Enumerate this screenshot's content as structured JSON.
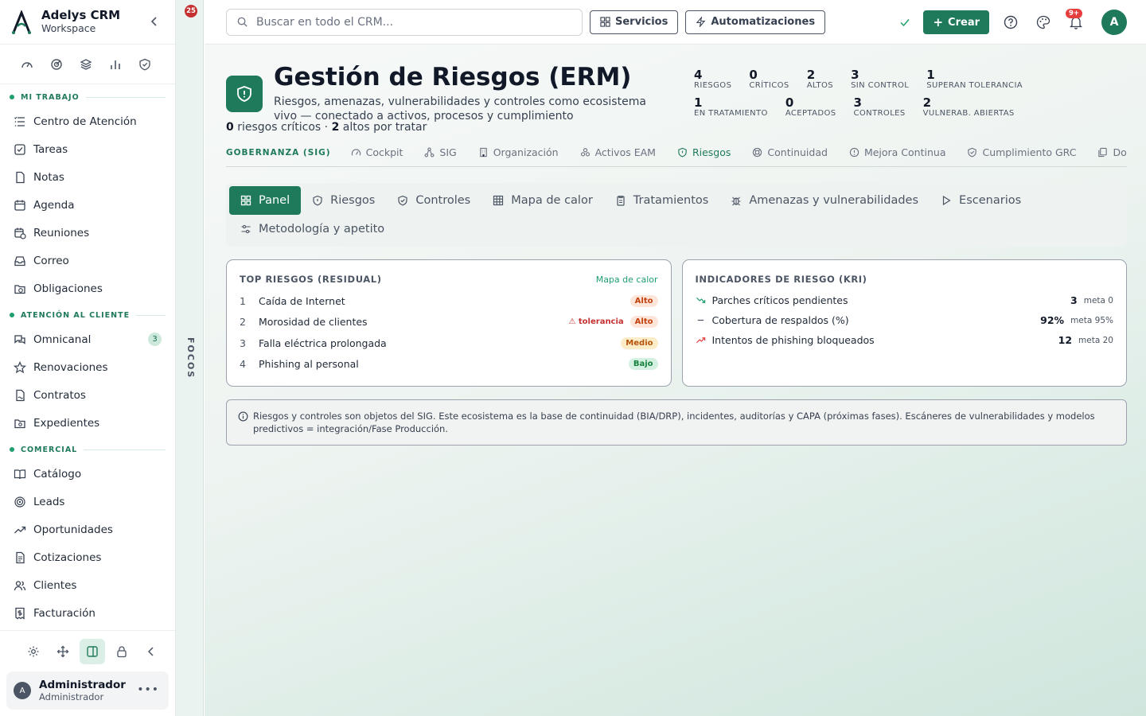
{
  "brand": {
    "name": "Adelys CRM",
    "sub": "Workspace"
  },
  "focos": {
    "badge": "25",
    "label": "FOCOS"
  },
  "sidebar": {
    "sections": [
      {
        "title": "MI TRABAJO",
        "items": [
          {
            "label": "Centro de Atención",
            "icon": "list-icon"
          },
          {
            "label": "Tareas",
            "icon": "checkbox-icon"
          },
          {
            "label": "Notas",
            "icon": "file-icon"
          },
          {
            "label": "Agenda",
            "icon": "calendar-icon"
          },
          {
            "label": "Reuniones",
            "icon": "calendar-clock-icon"
          },
          {
            "label": "Correo",
            "icon": "inbox-icon"
          },
          {
            "label": "Obligaciones",
            "icon": "folder-clock-icon"
          }
        ]
      },
      {
        "title": "ATENCIÓN AL CLIENTE",
        "items": [
          {
            "label": "Omnicanal",
            "icon": "chat-icon",
            "badge": "3"
          },
          {
            "label": "Renovaciones",
            "icon": "star-icon"
          },
          {
            "label": "Contratos",
            "icon": "file-signature-icon"
          },
          {
            "label": "Expedientes",
            "icon": "folder-search-icon"
          }
        ]
      },
      {
        "title": "COMERCIAL",
        "items": [
          {
            "label": "Catálogo",
            "icon": "book-open-icon"
          },
          {
            "label": "Leads",
            "icon": "target-icon"
          },
          {
            "label": "Oportunidades",
            "icon": "trending-up-icon"
          },
          {
            "label": "Cotizaciones",
            "icon": "file-text-icon"
          },
          {
            "label": "Clientes",
            "icon": "users-icon"
          },
          {
            "label": "Facturación",
            "icon": "receipt-icon"
          }
        ]
      }
    ],
    "user": {
      "name": "Administrador",
      "role": "Administrador",
      "initial": "A"
    }
  },
  "topbar": {
    "search_placeholder": "Buscar en todo el CRM...",
    "servicios": "Servicios",
    "automatizaciones": "Automatizaciones",
    "crear": "Crear",
    "notif_badge": "9+",
    "avatar": "A"
  },
  "page": {
    "title": "Gestión de Riesgos (ERM)",
    "subtitle": "Riesgos, amenazas, vulnerabilidades y controles como ecosistema vivo — conectado a activos, procesos y cumplimiento",
    "stats_row1": [
      {
        "n": "4",
        "l": "RIESGOS"
      },
      {
        "n": "0",
        "l": "CRÍTICOS"
      },
      {
        "n": "2",
        "l": "ALTOS"
      },
      {
        "n": "3",
        "l": "SIN CONTROL"
      },
      {
        "n": "1",
        "l": "SUPERAN TOLERANCIA"
      }
    ],
    "stats_row2": [
      {
        "n": "1",
        "l": "EN TRATAMIENTO"
      },
      {
        "n": "0",
        "l": "ACEPTADOS"
      },
      {
        "n": "3",
        "l": "CONTROLES"
      },
      {
        "n": "2",
        "l": "VULNERAB. ABIERTAS"
      }
    ],
    "summary": {
      "crit_n": "0",
      "crit_t": "riesgos críticos ·",
      "alto_n": "2",
      "alto_t": "altos por tratar"
    }
  },
  "module_tabs": {
    "group": "GOBERNANZA (SIG)",
    "tabs": [
      "Cockpit",
      "SIG",
      "Organización",
      "Activos EAM",
      "Riesgos",
      "Continuidad",
      "Mejora Continua",
      "Cumplimiento GRC",
      "Docu"
    ],
    "active": "Riesgos"
  },
  "sub_tabs": [
    "Panel",
    "Riesgos",
    "Controles",
    "Mapa de calor",
    "Tratamientos",
    "Amenazas y vulnerabilidades",
    "Escenarios",
    "Metodología y apetito"
  ],
  "top_risks": {
    "title": "TOP RIESGOS (RESIDUAL)",
    "link": "Mapa de calor",
    "rows": [
      {
        "num": "1",
        "name": "Caída de Internet",
        "level": "Alto",
        "tolerance": ""
      },
      {
        "num": "2",
        "name": "Morosidad de clientes",
        "level": "Alto",
        "tolerance": "⚠ tolerancia"
      },
      {
        "num": "3",
        "name": "Falla eléctrica prolongada",
        "level": "Medio",
        "tolerance": ""
      },
      {
        "num": "4",
        "name": "Phishing al personal",
        "level": "Bajo",
        "tolerance": ""
      }
    ]
  },
  "kri": {
    "title": "INDICADORES DE RIESGO (KRI)",
    "rows": [
      {
        "name": "Parches críticos pendientes",
        "value": "3",
        "meta": "meta 0",
        "trend": "down"
      },
      {
        "name": "Cobertura de respaldos (%)",
        "value": "92%",
        "meta": "meta 95%",
        "trend": "flat"
      },
      {
        "name": "Intentos de phishing bloqueados",
        "value": "12",
        "meta": "meta 20",
        "trend": "up"
      }
    ]
  },
  "note": "Riesgos y controles son objetos del SIG. Este ecosistema es la base de continuidad (BIA/DRP), incidentes, auditorías y CAPA (próximas fases). Escáneres de vulnerabilidades y modelos predictivos = integración/Fase Producción.",
  "colors": {
    "accent": "#1f7a5c",
    "alto": "#c2410c",
    "medio": "#b45309",
    "bajo": "#15803d",
    "danger": "#c53030"
  }
}
